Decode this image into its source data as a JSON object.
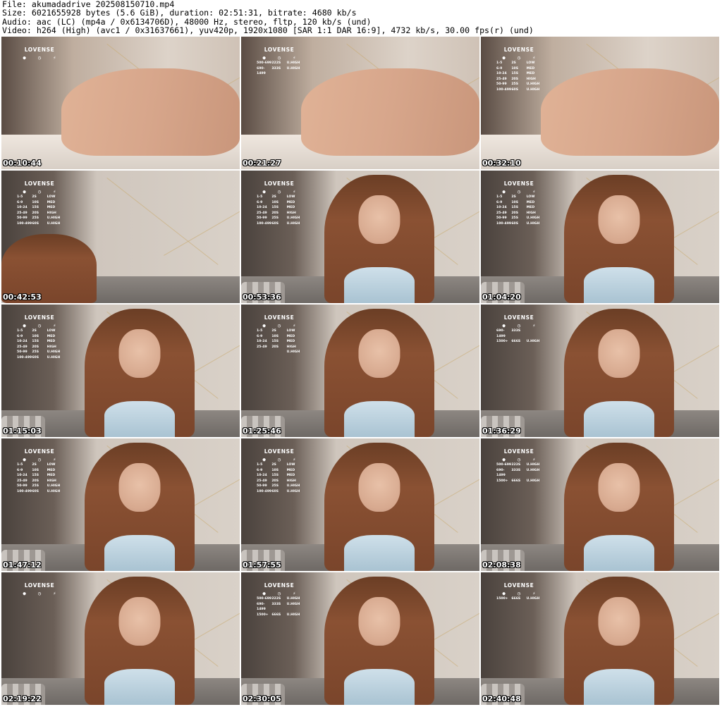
{
  "meta": {
    "file": "File: akumadadrive_202508150710.mp4",
    "size": "Size: 6021655928 bytes (5.6 GiB), duration: 02:51:31, bitrate: 4680 kb/s",
    "audio": "Audio: aac (LC) (mp4a / 0x6134706D), 48000 Hz, stereo, fltp, 120 kb/s (und)",
    "video": "Video: h264 (High) (avc1 / 0x31637661), yuv420p, 1920x1080 [SAR 1:1 DAR 16:9], 4732 kb/s, 30.00 fps(r) (und)"
  },
  "overlay": {
    "logo": "LOVENSE",
    "icon_glyphs": [
      "●",
      "◷",
      "⚡"
    ]
  },
  "thumbnails": [
    {
      "time": "00:10:44",
      "scene": "lying",
      "tiers": []
    },
    {
      "time": "00:21:27",
      "scene": "lying",
      "tiers": [
        [
          "500-699",
          "222S",
          "U.HIGH"
        ],
        [
          "690-1499",
          "333S",
          "U.HIGH"
        ]
      ]
    },
    {
      "time": "00:32:10",
      "scene": "lying",
      "tiers": [
        [
          "1-5",
          "2S",
          "LOW"
        ],
        [
          "6-9",
          "10S",
          "MED"
        ],
        [
          "10-24",
          "15S",
          "MED"
        ],
        [
          "25-49",
          "20S",
          "HIGH"
        ],
        [
          "50-99",
          "25S",
          "U.HIGH"
        ],
        [
          "100-499",
          "60S",
          "U.HIGH"
        ]
      ]
    },
    {
      "time": "00:42:53",
      "scene": "hair",
      "tiers": [
        [
          "1-5",
          "2S",
          "LOW"
        ],
        [
          "6-9",
          "10S",
          "MED"
        ],
        [
          "10-24",
          "15S",
          "MED"
        ],
        [
          "25-49",
          "20S",
          "HIGH"
        ],
        [
          "50-99",
          "25S",
          "U.HIGH"
        ],
        [
          "100-499",
          "60S",
          "U.HIGH"
        ]
      ]
    },
    {
      "time": "00:53:36",
      "scene": "portrait",
      "tiers": [
        [
          "1-5",
          "2S",
          "LOW"
        ],
        [
          "6-9",
          "10S",
          "MED"
        ],
        [
          "10-24",
          "15S",
          "MED"
        ],
        [
          "25-49",
          "20S",
          "HIGH"
        ],
        [
          "50-99",
          "25S",
          "U.HIGH"
        ],
        [
          "100-499",
          "60S",
          "U.HIGH"
        ]
      ]
    },
    {
      "time": "01:04:20",
      "scene": "portrait",
      "tiers": [
        [
          "1-5",
          "2S",
          "LOW"
        ],
        [
          "6-9",
          "10S",
          "MED"
        ],
        [
          "10-24",
          "15S",
          "MED"
        ],
        [
          "25-49",
          "20S",
          "HIGH"
        ],
        [
          "50-99",
          "25S",
          "U.HIGH"
        ],
        [
          "100-499",
          "60S",
          "U.HIGH"
        ]
      ]
    },
    {
      "time": "01:15:03",
      "scene": "portrait",
      "tiers": [
        [
          "1-5",
          "2S",
          "LOW"
        ],
        [
          "6-9",
          "10S",
          "MED"
        ],
        [
          "10-24",
          "15S",
          "MED"
        ],
        [
          "25-49",
          "20S",
          "HIGH"
        ],
        [
          "50-99",
          "25S",
          "U.HIGH"
        ],
        [
          "100-499",
          "60S",
          "U.HIGH"
        ]
      ]
    },
    {
      "time": "01:25:46",
      "scene": "portrait",
      "tiers": [
        [
          "1-5",
          "2S",
          "LOW"
        ],
        [
          "6-9",
          "10S",
          "MED"
        ],
        [
          "10-24",
          "15S",
          "MED"
        ],
        [
          "25-49",
          "20S",
          "HIGH"
        ],
        [
          "",
          "",
          "U.HIGH"
        ]
      ]
    },
    {
      "time": "01:36:29",
      "scene": "portrait",
      "tiers": [
        [
          "690-1499",
          "333S",
          ""
        ],
        [
          "1500+",
          "666S",
          "U.HIGH"
        ]
      ]
    },
    {
      "time": "01:47:12",
      "scene": "portrait",
      "tiers": [
        [
          "1-5",
          "2S",
          "LOW"
        ],
        [
          "6-9",
          "10S",
          "MED"
        ],
        [
          "10-24",
          "15S",
          "MED"
        ],
        [
          "25-49",
          "20S",
          "HIGH"
        ],
        [
          "50-99",
          "25S",
          "U.HIGH"
        ],
        [
          "100-499",
          "60S",
          "U.HIGH"
        ]
      ]
    },
    {
      "time": "01:57:55",
      "scene": "portrait",
      "tiers": [
        [
          "1-5",
          "2S",
          "LOW"
        ],
        [
          "6-9",
          "10S",
          "MED"
        ],
        [
          "10-24",
          "15S",
          "MED"
        ],
        [
          "25-49",
          "20S",
          "HIGH"
        ],
        [
          "50-99",
          "25S",
          "U.HIGH"
        ],
        [
          "100-499",
          "60S",
          "U.HIGH"
        ]
      ]
    },
    {
      "time": "02:08:38",
      "scene": "portrait",
      "tiers": [
        [
          "500-699",
          "222S",
          "U.HIGH"
        ],
        [
          "690-1499",
          "333S",
          "U.HIGH"
        ],
        [
          "1500+",
          "666S",
          "U.HIGH"
        ]
      ]
    },
    {
      "time": "02:19:22",
      "scene": "portrait",
      "tiers": []
    },
    {
      "time": "02:30:05",
      "scene": "portrait",
      "tiers": [
        [
          "500-699",
          "222S",
          "U.HIGH"
        ],
        [
          "690-1499",
          "333S",
          "U.HIGH"
        ],
        [
          "1500+",
          "666S",
          "U.HIGH"
        ]
      ]
    },
    {
      "time": "02:40:48",
      "scene": "portrait",
      "tiers": [
        [
          "1500+",
          "666S",
          "U.HIGH"
        ]
      ]
    }
  ]
}
